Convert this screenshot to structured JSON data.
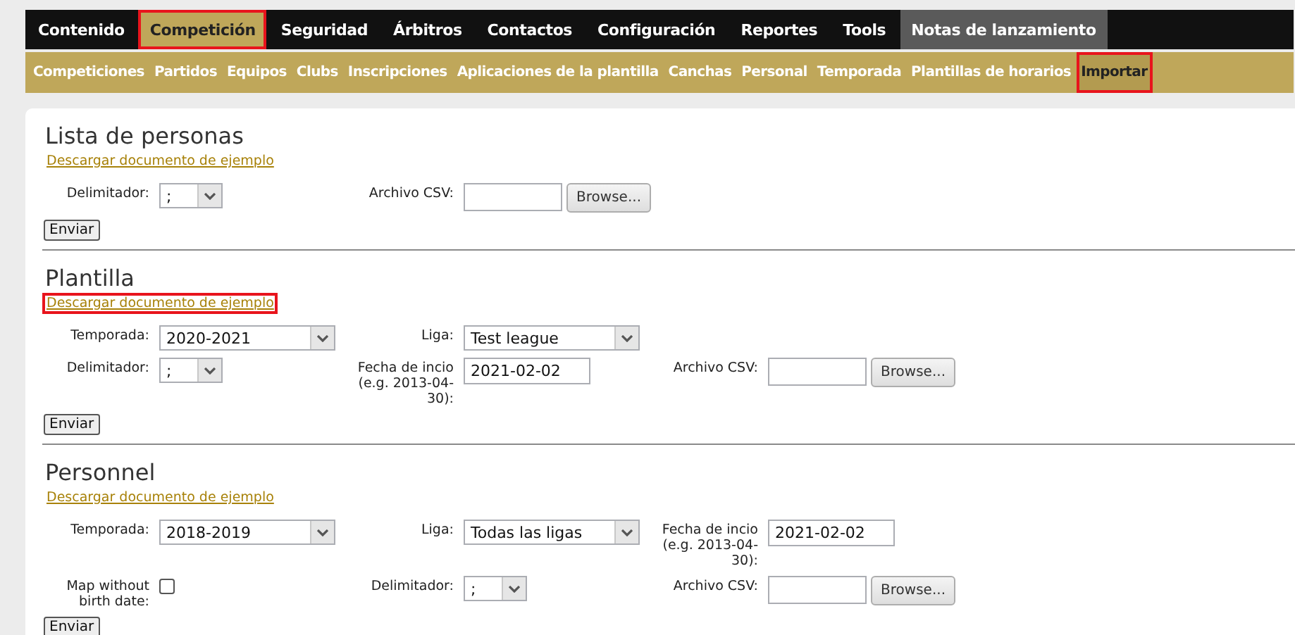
{
  "main_nav": [
    {
      "label": "Contenido",
      "kind": "menu",
      "selected": false,
      "highlighted": false
    },
    {
      "label": "Competición",
      "kind": "menu",
      "selected": true,
      "highlighted": true
    },
    {
      "label": "Seguridad",
      "kind": "menu",
      "selected": false,
      "highlighted": false
    },
    {
      "label": "Árbitros",
      "kind": "menu",
      "selected": false,
      "highlighted": false
    },
    {
      "label": "Contactos",
      "kind": "menu",
      "selected": false,
      "highlighted": false
    },
    {
      "label": "Configuración",
      "kind": "menu",
      "selected": false,
      "highlighted": false
    },
    {
      "label": "Reportes",
      "kind": "menu",
      "selected": false,
      "highlighted": false
    },
    {
      "label": "Tools",
      "kind": "menu",
      "selected": false,
      "highlighted": false
    },
    {
      "label": "Notas de lanzamiento",
      "kind": "notes",
      "selected": false,
      "highlighted": false
    }
  ],
  "sub_nav": [
    {
      "label": "Competiciones",
      "selected": false,
      "highlighted": false
    },
    {
      "label": "Partidos",
      "selected": false,
      "highlighted": false
    },
    {
      "label": "Equipos",
      "selected": false,
      "highlighted": false
    },
    {
      "label": "Clubs",
      "selected": false,
      "highlighted": false
    },
    {
      "label": "Inscripciones",
      "selected": false,
      "highlighted": false
    },
    {
      "label": "Aplicaciones de la plantilla",
      "selected": false,
      "highlighted": false
    },
    {
      "label": "Canchas",
      "selected": false,
      "highlighted": false
    },
    {
      "label": "Personal",
      "selected": false,
      "highlighted": false
    },
    {
      "label": "Temporada",
      "selected": false,
      "highlighted": false
    },
    {
      "label": "Plantillas de horarios",
      "selected": false,
      "highlighted": false
    },
    {
      "label": "Importar",
      "selected": true,
      "highlighted": true
    }
  ],
  "sections": [
    {
      "title": "Lista de personas",
      "link": {
        "text": "Descargar documento de ejemplo",
        "highlighted": false
      },
      "rows": [
        [
          {
            "kind": "select",
            "label": "Delimitador:",
            "value": ";"
          },
          {
            "kind": "file",
            "label": "Archivo CSV:",
            "button": "Browse..."
          }
        ]
      ],
      "submit": "Enviar"
    },
    {
      "title": "Plantilla",
      "link": {
        "text": "Descargar documento de ejemplo",
        "highlighted": true
      },
      "rows": [
        [
          {
            "kind": "select",
            "label": "Temporada:",
            "value": "2020-2021"
          },
          {
            "kind": "select",
            "label": "Liga:",
            "value": "Test league"
          }
        ],
        [
          {
            "kind": "select",
            "label": "Delimitador:",
            "value": ";"
          },
          {
            "kind": "text",
            "label": "Fecha de incio (e.g. 2013-04-30):",
            "value": "2021-02-02"
          },
          {
            "kind": "file",
            "label": "Archivo CSV:",
            "button": "Browse..."
          }
        ]
      ],
      "submit": "Enviar"
    },
    {
      "title": "Personnel",
      "link": {
        "text": "Descargar documento de ejemplo",
        "highlighted": false
      },
      "rows": [
        [
          {
            "kind": "select",
            "label": "Temporada:",
            "value": "2018-2019"
          },
          {
            "kind": "select",
            "label": "Liga:",
            "value": "Todas las ligas"
          },
          {
            "kind": "text",
            "label": "Fecha de incio (e.g. 2013-04-30):",
            "value": "2021-02-02"
          }
        ],
        [
          {
            "kind": "checkbox",
            "label": "Map without birth date:",
            "checked": false
          },
          {
            "kind": "select",
            "label": "Delimitador:",
            "value": ";"
          },
          {
            "kind": "file",
            "label": "Archivo CSV:",
            "button": "Browse..."
          }
        ]
      ],
      "submit": "Enviar"
    }
  ]
}
